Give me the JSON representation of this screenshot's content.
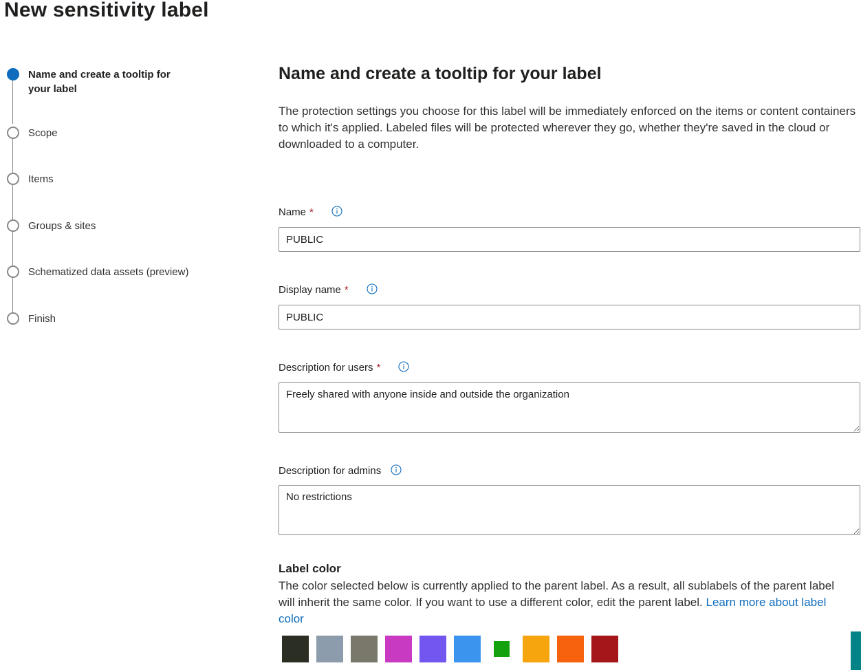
{
  "page": {
    "title": "New sensitivity label"
  },
  "steps": [
    {
      "label": "Name and create a tooltip for your label",
      "state": "current"
    },
    {
      "label": "Scope",
      "state": "pending"
    },
    {
      "label": "Items",
      "state": "pending"
    },
    {
      "label": "Groups & sites",
      "state": "pending"
    },
    {
      "label": "Schematized data assets (preview)",
      "state": "pending"
    },
    {
      "label": "Finish",
      "state": "pending"
    }
  ],
  "main": {
    "title": "Name and create a tooltip for your label",
    "intro": "The protection settings you choose for this label will be immediately enforced on the items or content containers to which it's applied. Labeled files will be protected wherever they go, whether they're saved in the cloud or downloaded to a computer."
  },
  "form": {
    "name": {
      "label": "Name",
      "required_mark": "*",
      "value": "PUBLIC"
    },
    "display_name": {
      "label": "Display name",
      "required_mark": "*",
      "value": "PUBLIC"
    },
    "description_users": {
      "label": "Description for users",
      "required_mark": "*",
      "value": "Freely shared with anyone inside and outside the organization"
    },
    "description_admins": {
      "label": "Description for admins",
      "value": "No restrictions"
    }
  },
  "label_color": {
    "title": "Label color",
    "description": "The color selected below is currently applied to the parent label. As a result, all sublabels of the parent label will inherit the same color. If you want to use a different color, edit the parent label.",
    "link_text": "Learn more about label color",
    "swatches": [
      "#2b2e23",
      "#8d9cad",
      "#7a776b",
      "#c93ac3",
      "#7355f0",
      "#3b95ef",
      "#13a10e",
      "#f7a50f",
      "#f7630c",
      "#a4161a"
    ],
    "selected_index": 6
  },
  "colors": {
    "accent": "#0f6cbd",
    "required": "#a4262c",
    "link": "#0f6cbd"
  }
}
